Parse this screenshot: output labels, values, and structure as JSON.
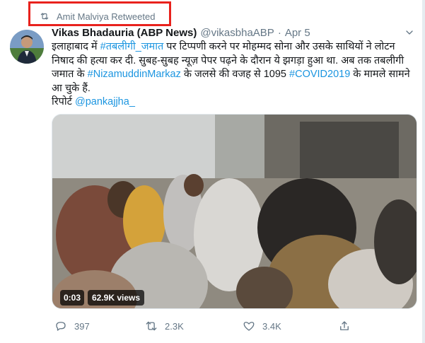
{
  "retweet_context": {
    "label": "Amit Malviya Retweeted",
    "icon": "retweet-icon"
  },
  "tweet": {
    "author": {
      "display_name": "Vikas Bhadauria (ABP News)",
      "handle": "@vikasbhaABP",
      "avatar": "avatar-photo"
    },
    "separator": "·",
    "date": "Apr 5",
    "body": {
      "line1_a": "इलाहाबाद में ",
      "hashtag1": "#तबलीगी_जमात",
      "line1_b": " पर टिप्पणी करने पर मोहम्मद सोना और उसके साथियों ने लोटन निषाद की हत्या कर दी. सुबह-सुबह न्यूज़ पेपर पढ़ने के दौरान ये झगड़ा हुआ था. अब तक तबलीगी जमात के ",
      "hashtag2": "#NizamuddinMarkaz",
      "line2_b": " के जलसे की वजह से 1095 ",
      "hashtag3": "#COVID2019",
      "line2_c": " के मामले सामने आ चुके हैं.",
      "report_label": "रिपोर्ट ",
      "mention": "@pankajjha_"
    },
    "media": {
      "type": "video",
      "time": "0:03",
      "views": "62.9K views"
    },
    "actions": {
      "replies": "397",
      "retweets": "2.3K",
      "likes": "3.4K"
    }
  },
  "colors": {
    "link": "#1b95e0",
    "muted": "#657786",
    "highlight_box": "#e8221d"
  }
}
